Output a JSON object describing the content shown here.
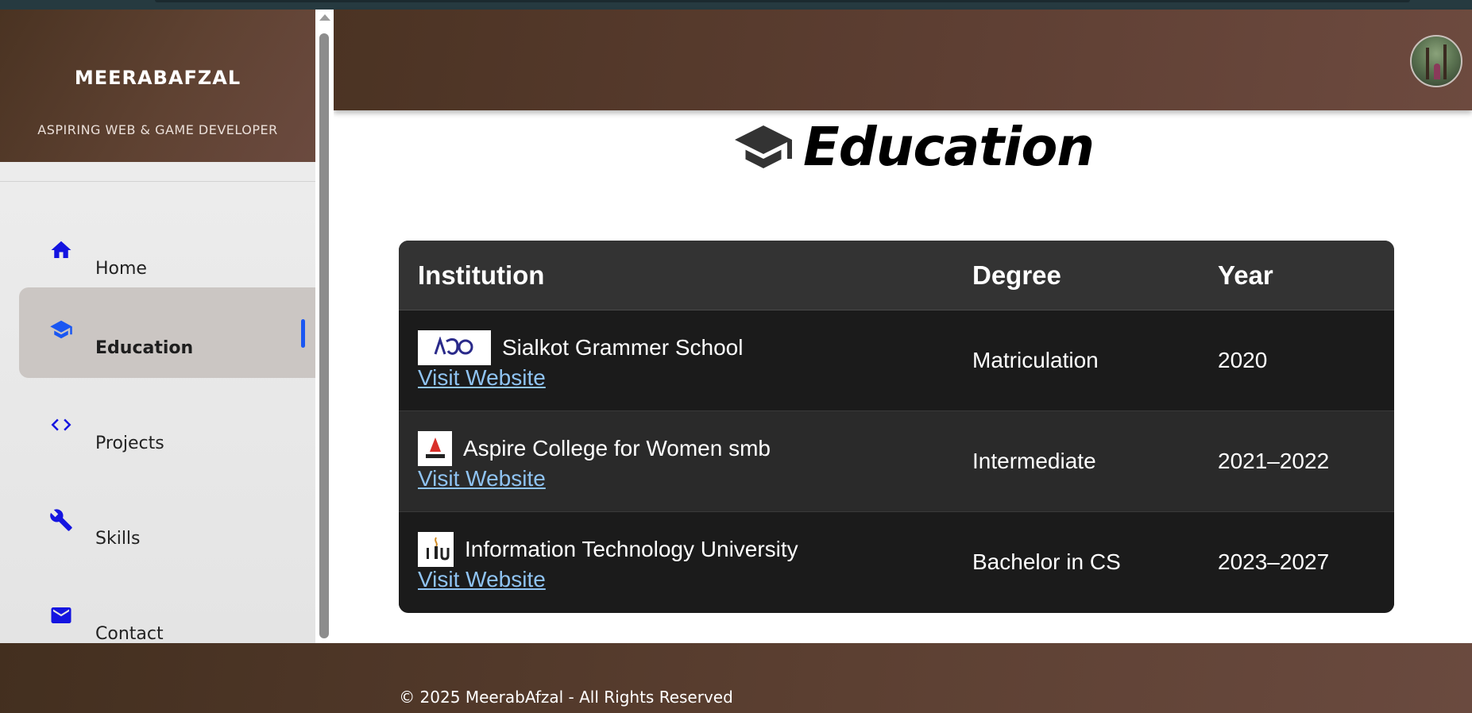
{
  "sidebar": {
    "brand": "MEERABAFZAL",
    "tagline": "ASPIRING WEB & GAME DEVELOPER",
    "items": [
      {
        "label": "Home",
        "icon": "home-icon"
      },
      {
        "label": "Education",
        "icon": "graduation-cap-icon",
        "active": true
      },
      {
        "label": "Projects",
        "icon": "code-icon"
      },
      {
        "label": "Skills",
        "icon": "wrench-icon"
      },
      {
        "label": "Contact",
        "icon": "mail-icon"
      }
    ]
  },
  "header": {
    "avatar": "profile-avatar"
  },
  "main": {
    "title": "Education",
    "title_icon": "graduation-cap-icon",
    "table": {
      "headers": [
        "Institution",
        "Degree",
        "Year"
      ],
      "rows": [
        {
          "institution": "Sialkot Grammer School",
          "logo": "SGS",
          "link": "Visit Website",
          "degree": "Matriculation",
          "year": "2020"
        },
        {
          "institution": "Aspire College for Women smb",
          "logo": "ASPIRE",
          "link": "Visit Website",
          "degree": "Intermediate",
          "year": "2021–2022"
        },
        {
          "institution": "Information Technology University",
          "logo": "ITU",
          "link": "Visit Website",
          "degree": "Bachelor in CS",
          "year": "2023–2027"
        }
      ]
    }
  },
  "footer": {
    "copyright": "© 2025 MeerabAfzal - All Rights Reserved"
  },
  "colors": {
    "brand_brown": "#5e3f33",
    "nav_icon_blue": "#1414e0",
    "link_blue": "#8fc3f2",
    "active_indicator": "#1a57f2"
  }
}
